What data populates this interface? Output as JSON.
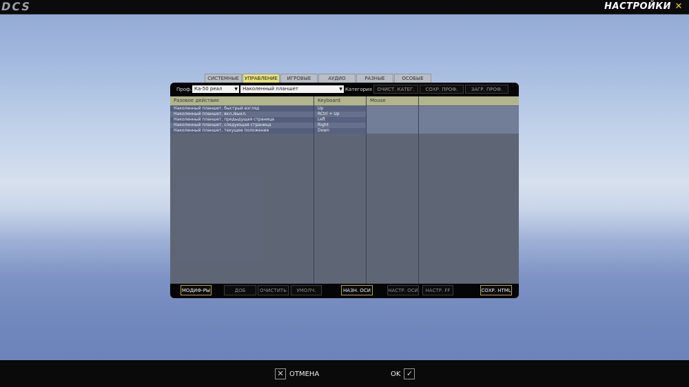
{
  "app": {
    "logo": "DCS",
    "title": "НАСТРОЙКИ",
    "close_glyph": "✕"
  },
  "tabs": [
    {
      "label": "СИСТЕМНЫЕ",
      "active": false
    },
    {
      "label": "УПРАВЛЕНИЕ",
      "active": true
    },
    {
      "label": "ИГРОВЫЕ",
      "active": false
    },
    {
      "label": "АУДИО",
      "active": false
    },
    {
      "label": "РАЗНЫЕ",
      "active": false
    },
    {
      "label": "ОСОБЫЕ",
      "active": false
    }
  ],
  "toolbar": {
    "profile_label": "Проф.",
    "profile_value": "Ка-50 реал",
    "category_value": "Наколенный планшет",
    "category_label": "Категория",
    "clear_category_button": "ОЧИСТ. КАТЕГ.",
    "save_profile_as_button": "СОХР. ПРОФ. КАК",
    "load_profile_button": "ЗАГР. ПРОФ."
  },
  "grid": {
    "columns": [
      "Разовое действие",
      "Keyboard",
      "Mouse",
      ""
    ],
    "rows": [
      {
        "action": "Наколенный планшет, быстрый взгляд",
        "keyboard": "Up"
      },
      {
        "action": "Наколенный планшет, вкл./выкл.",
        "keyboard": "RCtrl + Up"
      },
      {
        "action": "Наколенный планшет, предыдущая страница",
        "keyboard": "Left"
      },
      {
        "action": "Наколенный планшет, следующая страница",
        "keyboard": "Right"
      },
      {
        "action": "Наколенный планшет, текущее положение",
        "keyboard": "Down"
      }
    ]
  },
  "bottom_buttons": {
    "modifiers": "МОДИФ-РЫ",
    "add": "ДОБ",
    "clear": "ОЧИСТИТЬ",
    "default": "УМОЛЧ.",
    "axis_assign": "НАЗН. ОСИ",
    "axis_tune": "НАСТР. ОСИ",
    "ff_tune": "НАСТР. FF",
    "save_html": "СОХР. HTML"
  },
  "footer": {
    "cancel_label": "ОТМЕНА",
    "cancel_icon": "✕",
    "ok_label": "OK",
    "ok_icon": "✓"
  }
}
